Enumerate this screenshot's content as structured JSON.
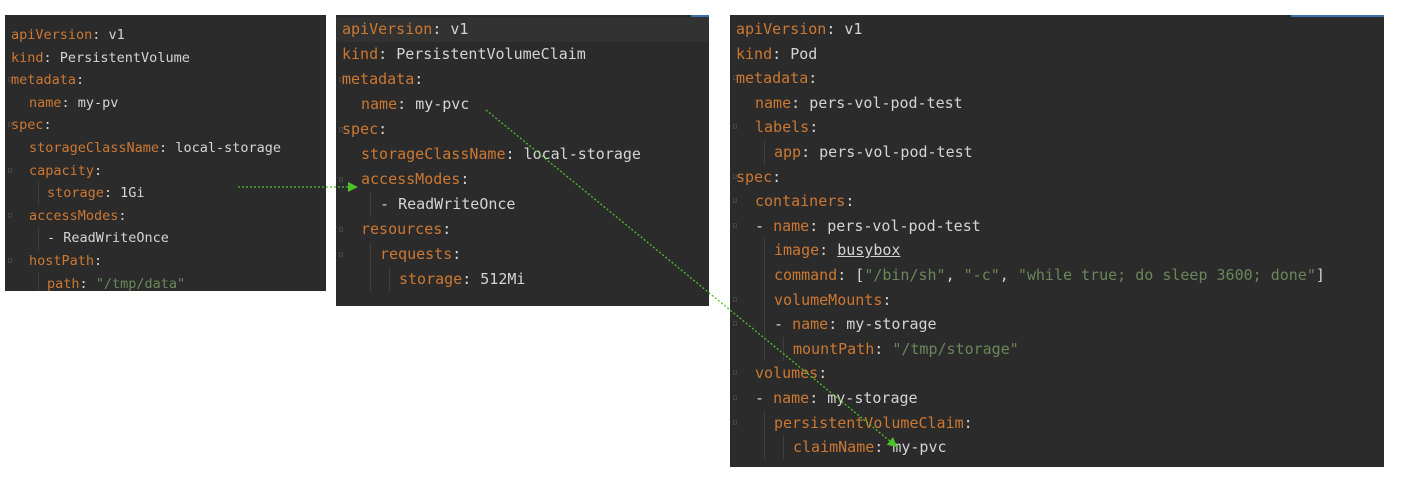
{
  "panels": {
    "pv": {
      "lines": [
        {
          "indent": 0,
          "parts": [
            {
              "t": "apiVersion",
              "c": "k"
            },
            {
              "t": ": ",
              "c": "p"
            },
            {
              "t": "v1",
              "c": "v"
            }
          ]
        },
        {
          "indent": 0,
          "parts": [
            {
              "t": "kind",
              "c": "k"
            },
            {
              "t": ": ",
              "c": "p"
            },
            {
              "t": "PersistentVolume",
              "c": "v"
            }
          ]
        },
        {
          "indent": 0,
          "parts": [
            {
              "t": "metadata",
              "c": "k"
            },
            {
              "t": ":",
              "c": "p"
            }
          ]
        },
        {
          "indent": 1,
          "parts": [
            {
              "t": "name",
              "c": "k"
            },
            {
              "t": ": ",
              "c": "p"
            },
            {
              "t": "my-pv",
              "c": "v"
            }
          ]
        },
        {
          "indent": 0,
          "parts": [
            {
              "t": "spec",
              "c": "k"
            },
            {
              "t": ":",
              "c": "p"
            }
          ]
        },
        {
          "indent": 1,
          "parts": [
            {
              "t": "storageClassName",
              "c": "k"
            },
            {
              "t": ": ",
              "c": "p"
            },
            {
              "t": "local-storage",
              "c": "v"
            }
          ]
        },
        {
          "indent": 1,
          "parts": [
            {
              "t": "capacity",
              "c": "k"
            },
            {
              "t": ":",
              "c": "p"
            }
          ]
        },
        {
          "indent": 2,
          "parts": [
            {
              "t": "storage",
              "c": "k"
            },
            {
              "t": ": ",
              "c": "p"
            },
            {
              "t": "1Gi",
              "c": "v"
            }
          ]
        },
        {
          "indent": 1,
          "parts": [
            {
              "t": "accessModes",
              "c": "k"
            },
            {
              "t": ":",
              "c": "p"
            }
          ]
        },
        {
          "indent": 2,
          "parts": [
            {
              "t": "- ",
              "c": "p"
            },
            {
              "t": "ReadWriteOnce",
              "c": "v"
            }
          ]
        },
        {
          "indent": 1,
          "parts": [
            {
              "t": "hostPath",
              "c": "k"
            },
            {
              "t": ":",
              "c": "p"
            }
          ]
        },
        {
          "indent": 2,
          "parts": [
            {
              "t": "path",
              "c": "k"
            },
            {
              "t": ": ",
              "c": "p"
            },
            {
              "t": "\"/tmp/data\"",
              "c": "s"
            }
          ]
        }
      ]
    },
    "pvc": {
      "lines": [
        {
          "indent": 0,
          "parts": [
            {
              "t": "apiVersion",
              "c": "k"
            },
            {
              "t": ": ",
              "c": "p"
            },
            {
              "t": "v1",
              "c": "v"
            }
          ]
        },
        {
          "indent": 0,
          "parts": [
            {
              "t": "kind",
              "c": "k"
            },
            {
              "t": ": ",
              "c": "p"
            },
            {
              "t": "PersistentVolumeClaim",
              "c": "v"
            }
          ]
        },
        {
          "indent": 0,
          "parts": [
            {
              "t": "metadata",
              "c": "k"
            },
            {
              "t": ":",
              "c": "p"
            }
          ]
        },
        {
          "indent": 1,
          "parts": [
            {
              "t": "name",
              "c": "k"
            },
            {
              "t": ": ",
              "c": "p"
            },
            {
              "t": "my-pvc",
              "c": "v"
            }
          ]
        },
        {
          "indent": 0,
          "parts": [
            {
              "t": "spec",
              "c": "k"
            },
            {
              "t": ":",
              "c": "p"
            }
          ]
        },
        {
          "indent": 1,
          "parts": [
            {
              "t": "storageClassName",
              "c": "k"
            },
            {
              "t": ": ",
              "c": "p"
            },
            {
              "t": "local-storage",
              "c": "v"
            }
          ]
        },
        {
          "indent": 1,
          "parts": [
            {
              "t": "accessModes",
              "c": "k"
            },
            {
              "t": ":",
              "c": "p"
            }
          ]
        },
        {
          "indent": 2,
          "parts": [
            {
              "t": "- ",
              "c": "p"
            },
            {
              "t": "ReadWriteOnce",
              "c": "v"
            }
          ]
        },
        {
          "indent": 1,
          "parts": [
            {
              "t": "resources",
              "c": "k"
            },
            {
              "t": ":",
              "c": "p"
            }
          ]
        },
        {
          "indent": 2,
          "parts": [
            {
              "t": "requests",
              "c": "k"
            },
            {
              "t": ":",
              "c": "p"
            }
          ]
        },
        {
          "indent": 3,
          "parts": [
            {
              "t": "storage",
              "c": "k"
            },
            {
              "t": ": ",
              "c": "p"
            },
            {
              "t": "512Mi",
              "c": "v"
            }
          ]
        }
      ]
    },
    "pod": {
      "lines": [
        {
          "indent": 0,
          "parts": [
            {
              "t": "apiVersion",
              "c": "k"
            },
            {
              "t": ": ",
              "c": "p"
            },
            {
              "t": "v1",
              "c": "v"
            }
          ]
        },
        {
          "indent": 0,
          "parts": [
            {
              "t": "kind",
              "c": "k"
            },
            {
              "t": ": ",
              "c": "p"
            },
            {
              "t": "Pod",
              "c": "v"
            }
          ]
        },
        {
          "indent": 0,
          "parts": [
            {
              "t": "metadata",
              "c": "k"
            },
            {
              "t": ":",
              "c": "p"
            }
          ]
        },
        {
          "indent": 1,
          "parts": [
            {
              "t": "name",
              "c": "k"
            },
            {
              "t": ": ",
              "c": "p"
            },
            {
              "t": "pers-vol-pod-test",
              "c": "v"
            }
          ]
        },
        {
          "indent": 1,
          "parts": [
            {
              "t": "labels",
              "c": "k"
            },
            {
              "t": ":",
              "c": "p"
            }
          ]
        },
        {
          "indent": 2,
          "parts": [
            {
              "t": "app",
              "c": "k"
            },
            {
              "t": ": ",
              "c": "p"
            },
            {
              "t": "pers-vol-pod-test",
              "c": "v"
            }
          ]
        },
        {
          "indent": 0,
          "parts": [
            {
              "t": "spec",
              "c": "k"
            },
            {
              "t": ":",
              "c": "p"
            }
          ]
        },
        {
          "indent": 1,
          "parts": [
            {
              "t": "containers",
              "c": "k"
            },
            {
              "t": ":",
              "c": "p"
            }
          ]
        },
        {
          "indent": 1,
          "parts": [
            {
              "t": "- ",
              "c": "p"
            },
            {
              "t": "name",
              "c": "k"
            },
            {
              "t": ": ",
              "c": "p"
            },
            {
              "t": "pers-vol-pod-test",
              "c": "v"
            }
          ]
        },
        {
          "indent": 2,
          "parts": [
            {
              "t": "image",
              "c": "k"
            },
            {
              "t": ": ",
              "c": "p"
            },
            {
              "t": "busybox",
              "c": "u"
            }
          ]
        },
        {
          "indent": 2,
          "parts": [
            {
              "t": "command",
              "c": "k"
            },
            {
              "t": ": [",
              "c": "p"
            },
            {
              "t": "\"/bin/sh\"",
              "c": "s"
            },
            {
              "t": ", ",
              "c": "p"
            },
            {
              "t": "\"-c\"",
              "c": "s"
            },
            {
              "t": ", ",
              "c": "p"
            },
            {
              "t": "\"while true; do sleep 3600; done\"",
              "c": "s"
            },
            {
              "t": "]",
              "c": "p"
            }
          ]
        },
        {
          "indent": 2,
          "parts": [
            {
              "t": "volumeMounts",
              "c": "k"
            },
            {
              "t": ":",
              "c": "p"
            }
          ]
        },
        {
          "indent": 2,
          "parts": [
            {
              "t": "- ",
              "c": "p"
            },
            {
              "t": "name",
              "c": "k"
            },
            {
              "t": ": ",
              "c": "p"
            },
            {
              "t": "my-storage",
              "c": "v"
            }
          ]
        },
        {
          "indent": 3,
          "parts": [
            {
              "t": "mountPath",
              "c": "k"
            },
            {
              "t": ": ",
              "c": "p"
            },
            {
              "t": "\"/tmp/storage\"",
              "c": "s"
            }
          ]
        },
        {
          "indent": 1,
          "parts": [
            {
              "t": "volumes",
              "c": "k"
            },
            {
              "t": ":",
              "c": "p"
            }
          ]
        },
        {
          "indent": 1,
          "parts": [
            {
              "t": "- ",
              "c": "p"
            },
            {
              "t": "name",
              "c": "k"
            },
            {
              "t": ": ",
              "c": "p"
            },
            {
              "t": "my-storage",
              "c": "v"
            }
          ]
        },
        {
          "indent": 2,
          "parts": [
            {
              "t": "persistentVolumeClaim",
              "c": "k"
            },
            {
              "t": ":",
              "c": "p"
            }
          ]
        },
        {
          "indent": 3,
          "parts": [
            {
              "t": "claimName",
              "c": "k"
            },
            {
              "t": ": ",
              "c": "p"
            },
            {
              "t": "my-pvc",
              "c": "v"
            }
          ]
        }
      ]
    }
  },
  "colors": {
    "editor_bg": "#2b2b2b",
    "key": "#cc7832",
    "value": "#d4d4d4",
    "string": "#6a8759",
    "arrow": "#4ec12a"
  },
  "arrows": [
    {
      "from": "pv storage: 1Gi",
      "to": "pvc accessModes"
    },
    {
      "from": "pvc name: my-pvc",
      "to": "pod claimName: my-pvc"
    }
  ]
}
